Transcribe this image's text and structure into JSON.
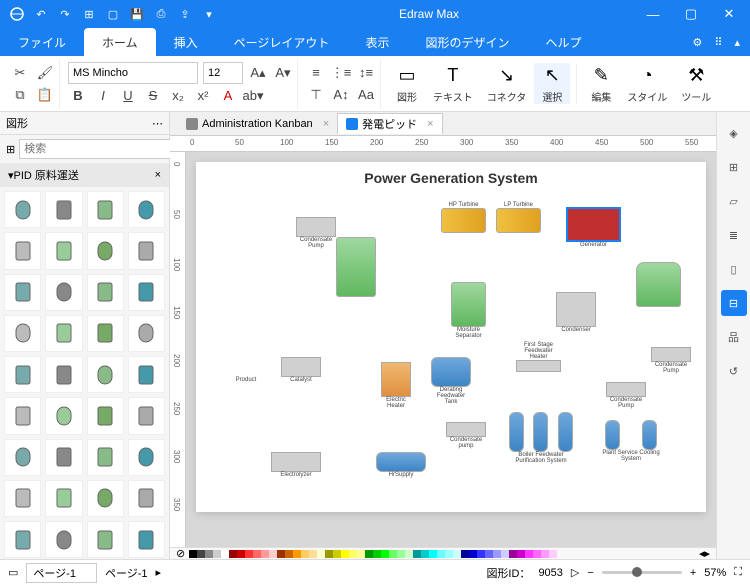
{
  "app_title": "Edraw Max",
  "menubar": {
    "file": "ファイル",
    "home": "ホーム",
    "insert": "挿入",
    "page_layout": "ページレイアウト",
    "view": "表示",
    "shape_design": "図形のデザイン",
    "help": "ヘルプ"
  },
  "ribbon": {
    "font_name": "MS Mincho",
    "font_size": "12",
    "group_shape": "図形",
    "group_text": "テキスト",
    "group_connector": "コネクタ",
    "group_select": "選択",
    "group_edit": "編集",
    "group_style": "スタイル",
    "group_tool": "ツール"
  },
  "left_panel": {
    "title": "図形",
    "search_placeholder": "検索",
    "category": "PID 原料運送"
  },
  "doc_tabs": {
    "tab1": "Administration Kanban",
    "tab2": "発電ピッド"
  },
  "ruler_marks": [
    "0",
    "50",
    "100",
    "150",
    "200",
    "250",
    "300",
    "350",
    "400",
    "450",
    "500",
    "550"
  ],
  "vruler_marks": [
    "0",
    "50",
    "100",
    "150",
    "200",
    "250",
    "300",
    "350"
  ],
  "diagram": {
    "title": "Power Generation System",
    "labels": {
      "condensate_pump": "Condensate Pump",
      "catalyst": "Catalyst",
      "product": "Product",
      "electrolyzer": "Electrolyzer",
      "electric_heater": "Electric Heater",
      "h_supply": "HrSupply",
      "derating_feedwater_tank": "Derating Feedwater Tank",
      "condensate_pump2": "Condensate pump",
      "moisture_separator": "Moisture Separator",
      "hp_turbine": "HP Turbine",
      "lp_turbine": "LP Turbine",
      "first_stage_heater": "First Stage Feedwater Heater",
      "boiler_feedwater": "Boiler Feedwater Purification System",
      "generator": "Generator",
      "condenser": "Condenser",
      "condensate_pump3": "Condensate Pump",
      "condensate_pump4": "Condensate Pump",
      "plant_service": "Plant Service Cooling System"
    }
  },
  "right_tools": [
    "diamond",
    "grid",
    "image",
    "layers",
    "doc",
    "calc",
    "hierarchy",
    "history"
  ],
  "statusbar": {
    "page_dropdown": "ページ-1",
    "page_tab": "ページ-1",
    "shape_id_label": "図形ID：",
    "shape_id_value": "9053",
    "zoom_value": "57%"
  },
  "color_swatches": [
    "#000",
    "#444",
    "#888",
    "#ccc",
    "#fff",
    "#900",
    "#c00",
    "#f33",
    "#f66",
    "#f99",
    "#fcc",
    "#930",
    "#c60",
    "#f90",
    "#fc6",
    "#fd9",
    "#ffc",
    "#990",
    "#cc0",
    "#ff0",
    "#ff6",
    "#ff9",
    "#090",
    "#0c0",
    "#0f0",
    "#6f6",
    "#9f9",
    "#cfc",
    "#099",
    "#0cc",
    "#0ff",
    "#6ff",
    "#9ff",
    "#cff",
    "#009",
    "#00c",
    "#33f",
    "#66f",
    "#99f",
    "#ccf",
    "#909",
    "#c0c",
    "#f3f",
    "#f6f",
    "#f9f",
    "#fcf"
  ]
}
